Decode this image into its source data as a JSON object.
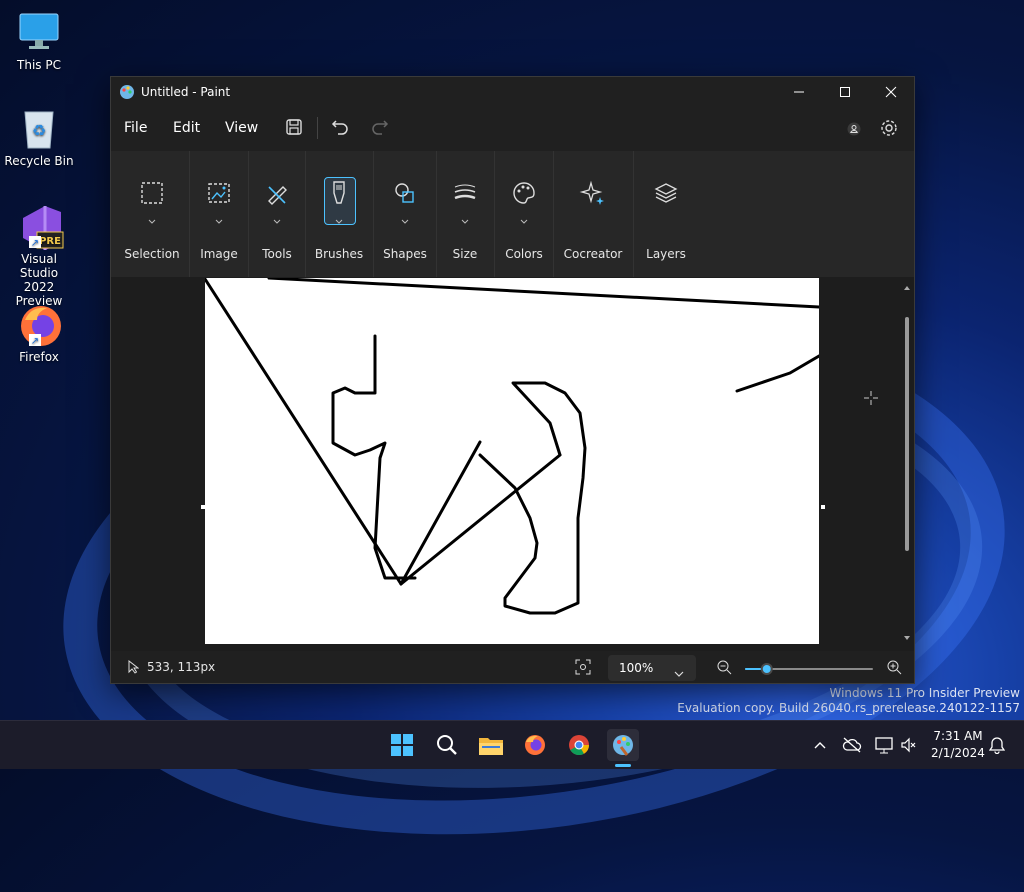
{
  "desktop": {
    "icons": [
      {
        "label": "This PC"
      },
      {
        "label": "Recycle Bin"
      },
      {
        "label": "Visual Studio 2022 Preview",
        "line1": "Visual Studio",
        "line2": "2022 Preview",
        "badge": "PRE"
      },
      {
        "label": "Firefox"
      }
    ],
    "watermark": {
      "line1": "Windows 11 Pro Insider Preview",
      "line2": "Evaluation copy. Build 26040.rs_prerelease.240122-1157"
    }
  },
  "window": {
    "title": "Untitled - Paint",
    "menu": {
      "file": "File",
      "edit": "Edit",
      "view": "View"
    },
    "ribbon": {
      "groups": [
        {
          "label": "Selection",
          "icon": "selection-icon"
        },
        {
          "label": "Image",
          "icon": "image-icon"
        },
        {
          "label": "Tools",
          "icon": "tools-icon"
        },
        {
          "label": "Brushes",
          "icon": "brush-icon",
          "active": true
        },
        {
          "label": "Shapes",
          "icon": "shapes-icon"
        },
        {
          "label": "Size",
          "icon": "size-icon"
        },
        {
          "label": "Colors",
          "icon": "palette-icon"
        },
        {
          "label": "Cocreator",
          "icon": "sparkle-icon"
        },
        {
          "label": "Layers",
          "icon": "layers-icon"
        }
      ]
    },
    "status": {
      "cursor_position": "533, 113px",
      "zoom": "100%",
      "zoom_slider_value": 0.17
    }
  },
  "taskbar": {
    "apps": [
      "start-icon",
      "search-icon",
      "file-explorer-icon",
      "firefox-icon",
      "chrome-icon",
      "paint-icon"
    ],
    "clock": {
      "time": "7:31 AM",
      "date": "2/1/2024"
    }
  },
  "colors": {
    "accent": "#4cc2ff",
    "window_bg": "#202020",
    "ribbon_bg": "#272727"
  }
}
